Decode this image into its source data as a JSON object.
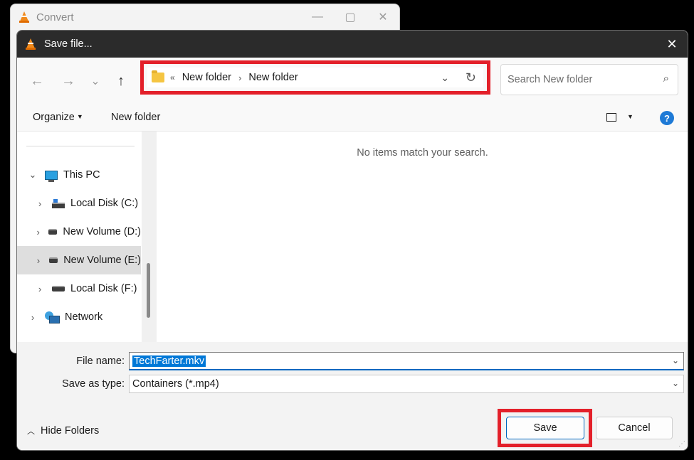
{
  "background_window": {
    "title": "Convert",
    "controls": [
      "—",
      "▢",
      "✕"
    ]
  },
  "dialog": {
    "title": "Save file...",
    "close": "✕"
  },
  "nav": {
    "back": "←",
    "forward": "→",
    "recent": "⌄",
    "up": "↑"
  },
  "address": {
    "overflow": "«",
    "crumbs": [
      "New folder",
      "New folder"
    ],
    "separator": "›",
    "dropdown": "⌄",
    "refresh": "↻"
  },
  "search": {
    "placeholder": "Search New folder",
    "icon": "⌕"
  },
  "toolbar": {
    "organize": "Organize",
    "new_folder": "New folder",
    "help": "?"
  },
  "sidebar": {
    "items": [
      {
        "label": "This PC",
        "chevron": "⌄",
        "icon": "pc-icon"
      },
      {
        "label": "Local Disk (C:)",
        "chevron": "›",
        "icon": "windows-disk-icon"
      },
      {
        "label": "New Volume (D:)",
        "chevron": "›",
        "icon": "disk-icon"
      },
      {
        "label": "New Volume (E:)",
        "chevron": "›",
        "icon": "disk-icon"
      },
      {
        "label": "Local Disk (F:)",
        "chevron": "›",
        "icon": "disk-icon"
      },
      {
        "label": "Network",
        "chevron": "›",
        "icon": "network-icon"
      }
    ]
  },
  "content": {
    "empty_message": "No items match your search."
  },
  "form": {
    "file_name_label": "File name:",
    "file_name_value": "TechFarter.mkv",
    "save_type_label": "Save as type:",
    "save_type_value": "Containers (*.mp4)"
  },
  "footer": {
    "hide_folders": "Hide Folders",
    "save": "Save",
    "cancel": "Cancel"
  },
  "colors": {
    "highlight_box": "#e3202a",
    "accent": "#0067c0",
    "titlebar": "#2b2b2b"
  }
}
